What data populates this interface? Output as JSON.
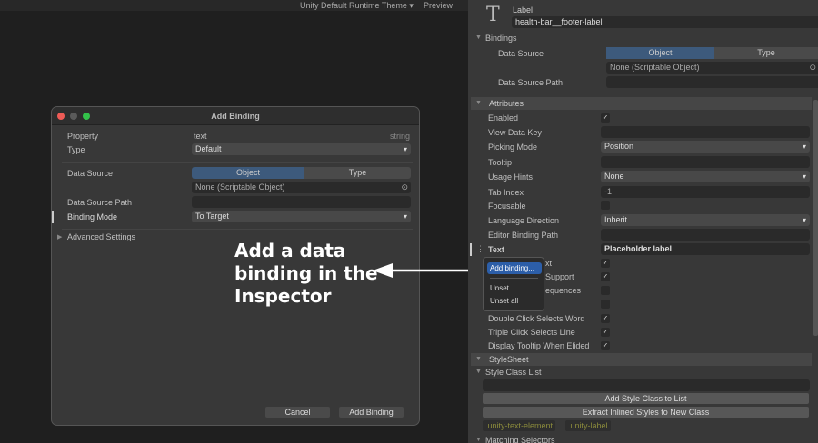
{
  "toolbar": {
    "theme": "Unity Default Runtime Theme ▾",
    "preview": "Preview"
  },
  "dialog": {
    "title": "Add Binding",
    "property_label": "Property",
    "property_value": "text",
    "property_type": "string",
    "type_label": "Type",
    "type_value": "Default",
    "data_source_label": "Data Source",
    "seg_object": "Object",
    "seg_type": "Type",
    "object_field": "None (Scriptable Object)",
    "data_source_path_label": "Data Source Path",
    "binding_mode_label": "Binding Mode",
    "binding_mode_value": "To Target",
    "advanced": "Advanced Settings",
    "cancel": "Cancel",
    "add": "Add Binding"
  },
  "callout": {
    "line1": "Add a data",
    "line2": "binding in the",
    "line3": "Inspector"
  },
  "inspector": {
    "element_type": "Label",
    "element_name": "health-bar__footer-label",
    "bindings": {
      "title": "Bindings",
      "data_source": "Data Source",
      "seg_object": "Object",
      "seg_type": "Type",
      "object_field": "None (Scriptable Object)",
      "data_source_path": "Data Source Path"
    },
    "attributes": {
      "title": "Attributes",
      "enabled": "Enabled",
      "view_data_key": "View Data Key",
      "picking_mode": "Picking Mode",
      "picking_mode_value": "Position",
      "tooltip": "Tooltip",
      "usage_hints": "Usage Hints",
      "usage_hints_value": "None",
      "tab_index": "Tab Index",
      "tab_index_value": "-1",
      "focusable": "Focusable",
      "language_direction": "Language Direction",
      "language_direction_value": "Inherit",
      "editor_binding_path": "Editor Binding Path",
      "text": "Text",
      "text_value": "Placeholder label",
      "partial1": "xt",
      "partial2": "Support",
      "partial3": "equences",
      "double_click": "Double Click Selects Word",
      "triple_click": "Triple Click Selects Line",
      "display_tooltip": "Display Tooltip When Elided"
    },
    "popup": {
      "add_binding": "Add binding...",
      "unset": "Unset",
      "unset_all": "Unset all"
    },
    "stylesheet": {
      "title": "StyleSheet",
      "class_list": "Style Class List",
      "add_class": "Add Style Class to List",
      "extract": "Extract Inlined Styles to New Class",
      "class1": ".unity-text-element",
      "class2": ".unity-label",
      "matching": "Matching Selectors"
    }
  },
  "colors": {
    "accent": "#2c5ea8",
    "segment_selected": "#3d5a7c",
    "class_tag": "#8a8a3c"
  }
}
